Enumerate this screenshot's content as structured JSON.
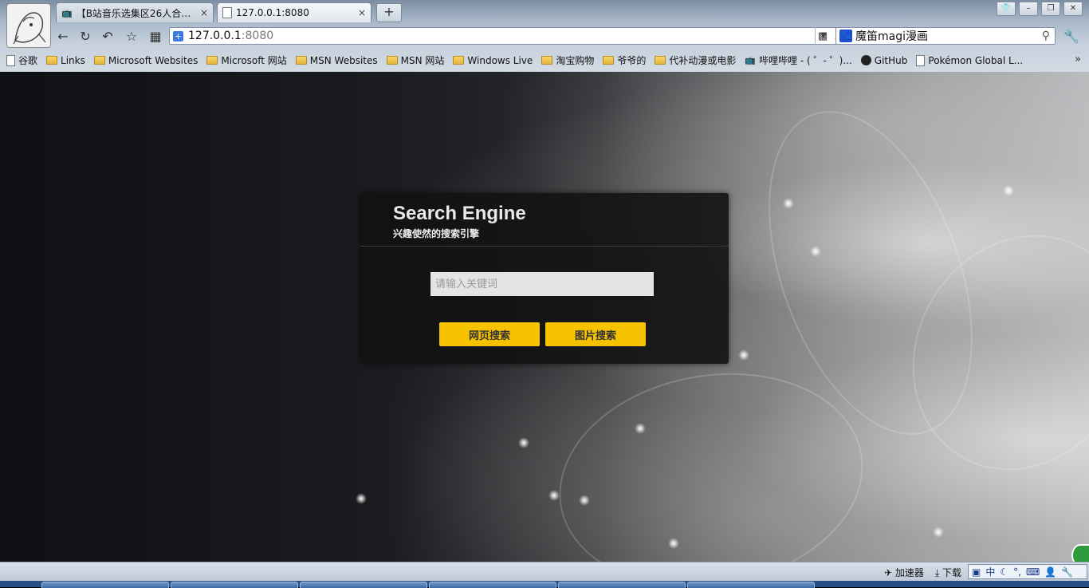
{
  "tabs": [
    {
      "label": "【B站音乐选集区26人合作】",
      "close": "×"
    },
    {
      "label": "127.0.0.1:8080",
      "close": "×"
    }
  ],
  "new_tab": "+",
  "address": {
    "host": "127.0.0.1",
    "port": ":8080"
  },
  "search_box": {
    "value": "魔笛magi漫画"
  },
  "bookmarks": [
    {
      "label": "谷歌",
      "icon": "page-icon"
    },
    {
      "label": "Links",
      "icon": "folder-icon"
    },
    {
      "label": "Microsoft Websites",
      "icon": "folder-icon"
    },
    {
      "label": "Microsoft 网站",
      "icon": "folder-icon"
    },
    {
      "label": "MSN Websites",
      "icon": "folder-icon"
    },
    {
      "label": "MSN 网站",
      "icon": "folder-icon"
    },
    {
      "label": "Windows Live",
      "icon": "folder-icon"
    },
    {
      "label": "淘宝购物",
      "icon": "folder-icon"
    },
    {
      "label": "爷爷的",
      "icon": "folder-icon"
    },
    {
      "label": "代补动漫或电影",
      "icon": "folder-icon"
    },
    {
      "label": "哔哩哔哩 - ( ゜- ゜)...",
      "icon": "bilibili-icon"
    },
    {
      "label": "GitHub",
      "icon": "github-icon"
    },
    {
      "label": "Pokémon Global L...",
      "icon": "page-icon"
    }
  ],
  "search_engine": {
    "title": "Search Engine",
    "subtitle": "兴趣使然的搜索引擎",
    "input_placeholder": "请输入关键词",
    "web_search_label": "网页搜索",
    "image_search_label": "图片搜索",
    "button_color": "#f7c200"
  },
  "status": {
    "accelerator": "加速器",
    "download": "下载",
    "ime_mode": "中"
  }
}
